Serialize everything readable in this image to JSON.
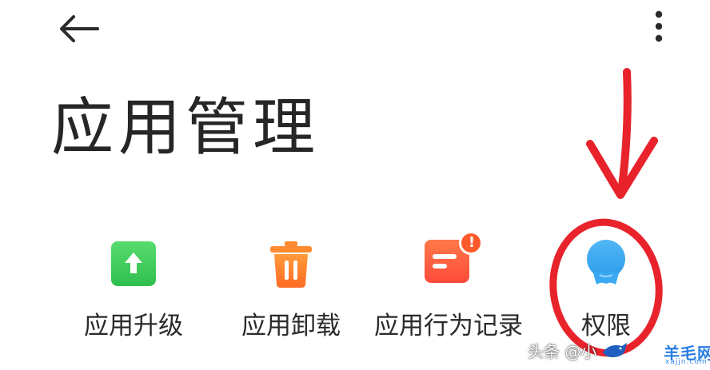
{
  "header": {
    "back_icon": "arrow-left-icon",
    "more_icon": "vertical-dots-icon"
  },
  "page": {
    "title": "应用管理"
  },
  "tiles": [
    {
      "label": "应用升级",
      "icon": "upgrade-arrow-up-icon",
      "color": "#3ec95a"
    },
    {
      "label": "应用卸载",
      "icon": "trash-bin-icon",
      "color": "#ff7a2e"
    },
    {
      "label": "应用行为记录",
      "icon": "behavior-log-icon",
      "color": "#ff5a3c",
      "badge": "!"
    },
    {
      "label": "权限",
      "icon": "permission-person-icon",
      "color": "#3aa8f2"
    }
  ],
  "annotation": {
    "color": "#e8232b"
  },
  "watermark": {
    "source": "头条 @小",
    "site": "羊毛网",
    "url": "xajjn.com"
  }
}
